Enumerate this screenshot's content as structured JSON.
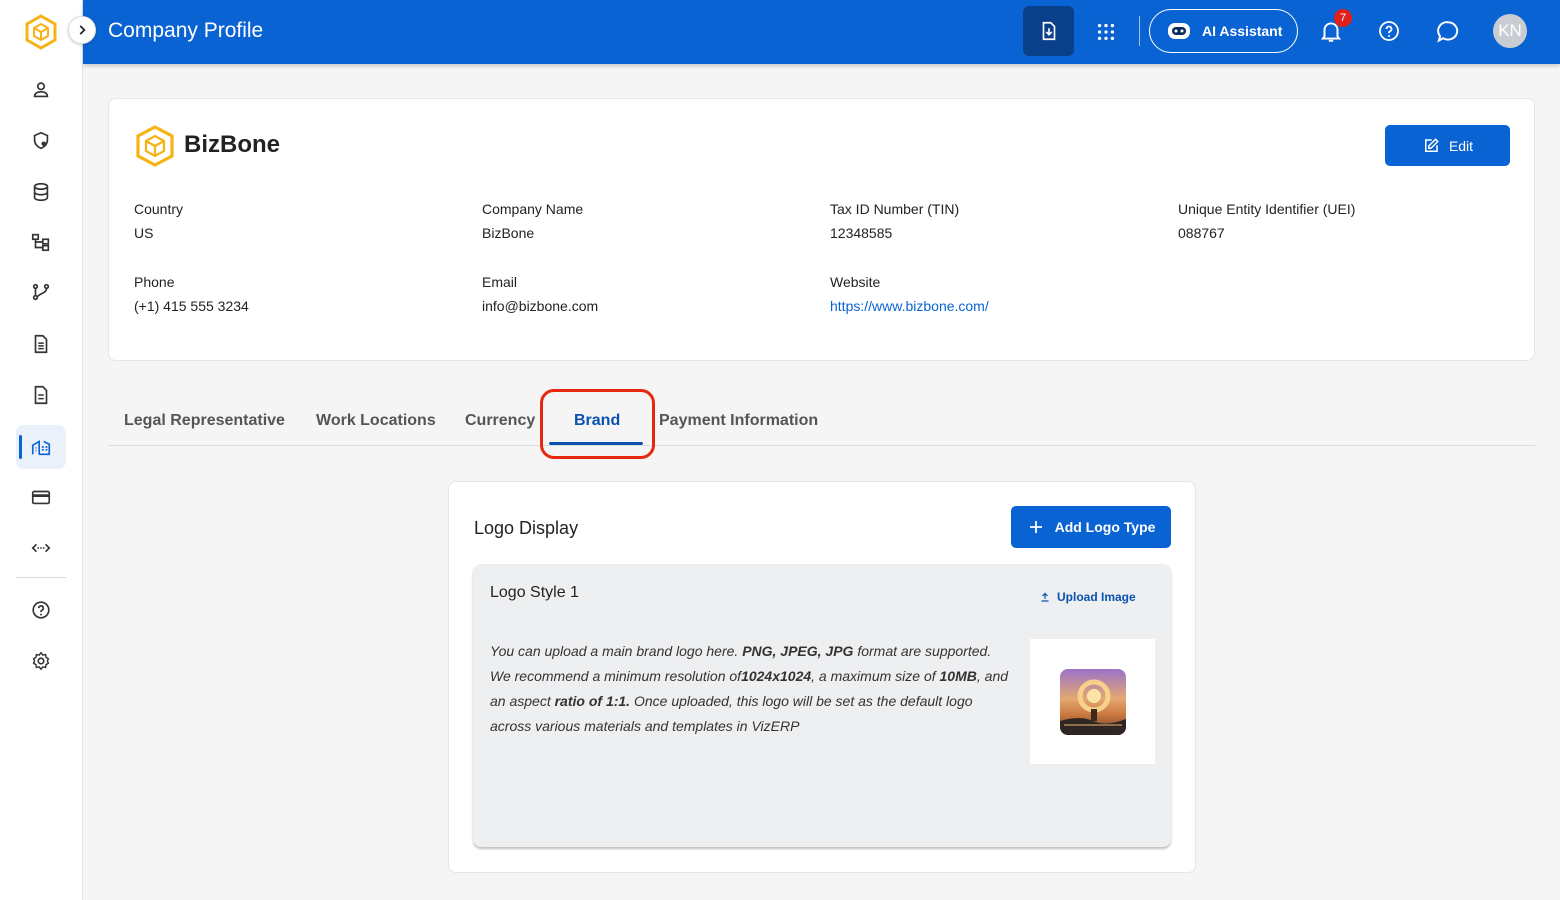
{
  "app": {
    "page_title": "Company Profile",
    "ai_assistant_label": "AI Assistant",
    "notification_count": "7",
    "user_initials": "KN",
    "accent_color": "#0a63d3"
  },
  "sidebar": {
    "items": [
      {
        "icon": "user-icon"
      },
      {
        "icon": "security-settings-icon"
      },
      {
        "icon": "database-icon"
      },
      {
        "icon": "org-structure-icon"
      },
      {
        "icon": "workflow-icon"
      },
      {
        "icon": "document-icon"
      },
      {
        "icon": "document-list-icon"
      },
      {
        "icon": "company-building-icon",
        "active": true
      },
      {
        "icon": "credit-card-icon"
      },
      {
        "icon": "integration-icon"
      },
      {
        "icon": "help-icon"
      },
      {
        "icon": "settings-icon"
      }
    ]
  },
  "company": {
    "name": "BizBone",
    "edit_label": "Edit",
    "fields": {
      "country": {
        "label": "Country",
        "value": "US"
      },
      "company_name": {
        "label": "Company Name",
        "value": "BizBone"
      },
      "tin": {
        "label": "Tax ID Number (TIN)",
        "value": "12348585"
      },
      "uei": {
        "label": "Unique Entity Identifier (UEI)",
        "value": "088767"
      },
      "phone": {
        "label": "Phone",
        "value": "(+1) 415 555 3234"
      },
      "email": {
        "label": "Email",
        "value": "info@bizbone.com"
      },
      "website": {
        "label": "Website",
        "value": "https://www.bizbone.com/"
      }
    }
  },
  "tabs": [
    {
      "label": "Legal Representative"
    },
    {
      "label": "Work Locations"
    },
    {
      "label": "Currency"
    },
    {
      "label": "Brand",
      "active": true
    },
    {
      "label": "Payment Information"
    }
  ],
  "logo_display": {
    "title": "Logo Display",
    "add_button_label": "Add Logo Type",
    "styles": [
      {
        "title": "Logo Style 1",
        "upload_label": "Upload Image",
        "desc_1": "You can upload a main brand logo here. ",
        "desc_2": "PNG, JPEG, JPG",
        "desc_3": " format are supported. We recommend a minimum resolution of",
        "desc_4": "1024x1024",
        "desc_5": ", a maximum size of ",
        "desc_6": "10MB",
        "desc_7": ", and an aspect ",
        "desc_8": "ratio of 1:1.",
        "desc_9": " Once uploaded, this logo will be set as the default logo across various materials and templates in VizERP"
      }
    ]
  }
}
